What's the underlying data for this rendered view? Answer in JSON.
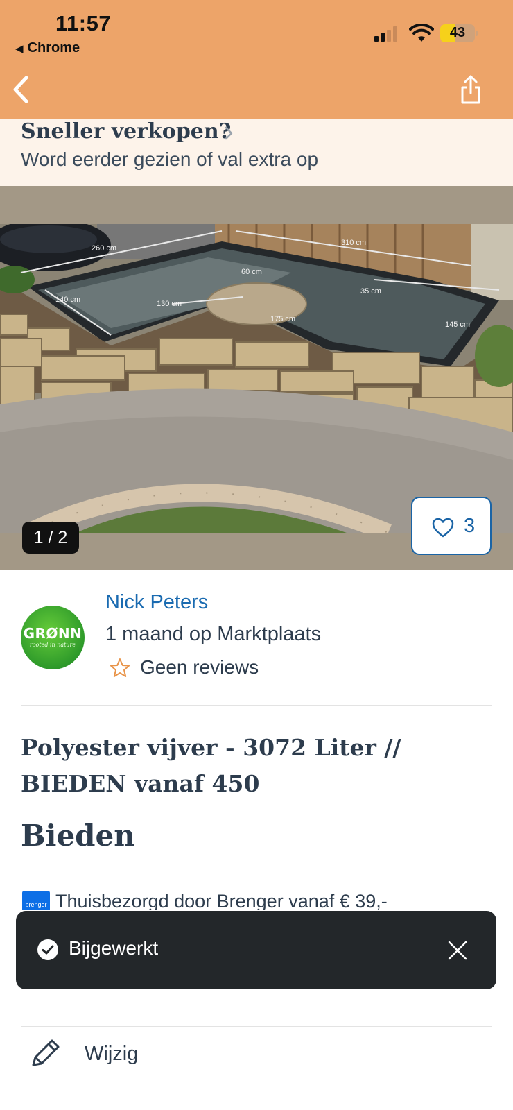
{
  "status_bar": {
    "time": "11:57",
    "back_app_label": "Chrome",
    "battery_level": "43"
  },
  "header": {
    "background_color": "#eda469",
    "back_icon": "chevron-left-icon",
    "share_icon": "share-icon"
  },
  "promo": {
    "title": "Sneller verkopen?",
    "subtitle": "Word eerder gezien of val extra op"
  },
  "gallery": {
    "counter": "1 / 2",
    "favorite_count": "3",
    "photo_labels": [
      "260 cm",
      "310 cm",
      "60 cm",
      "140 cm",
      "130 cm",
      "35 cm",
      "175 cm",
      "145 cm"
    ]
  },
  "seller": {
    "avatar_text": "GRØNN",
    "avatar_tagline": "rooted in nature",
    "name": "Nick Peters",
    "since": "1 maand op Marktplaats",
    "reviews": "Geen reviews"
  },
  "listing": {
    "title": "Polyester vijver - 3072 Liter // BIEDEN vanaf 450",
    "price": "Bieden",
    "delivery_icon_label": "brenger",
    "delivery_text": "Thuisbezorgd door Brenger vanaf € 39,-"
  },
  "toast": {
    "message": "Bijgewerkt"
  },
  "actions": {
    "edit_label": "Wijzig"
  }
}
